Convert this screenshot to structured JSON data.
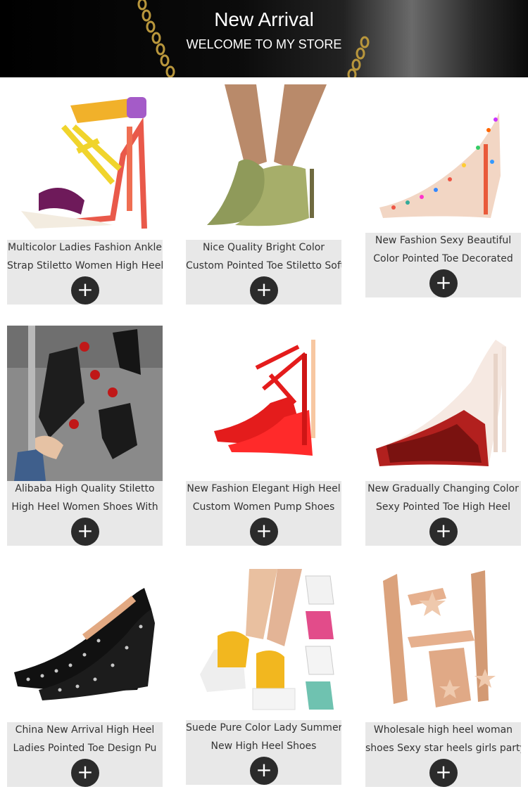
{
  "banner": {
    "title": "New Arrival",
    "subtitle": "WELCOME TO MY STORE"
  },
  "products": [
    {
      "line1": "Multicolor Ladies Fashion Ankle",
      "line2": "Strap Stiletto Women High Heel",
      "add_label": "+",
      "image_icon": "strappy-sandal-image"
    },
    {
      "line1": "Nice Quality Bright Color",
      "line2": "Custom Pointed Toe Stiletto Soft",
      "add_label": "+",
      "image_icon": "olive-mule-image"
    },
    {
      "line1": "New Fashion Sexy Beautiful",
      "line2": "Color Pointed Toe Decorated",
      "add_label": "+",
      "image_icon": "studded-pump-image"
    },
    {
      "line1": "Alibaba High Quality Stiletto",
      "line2": "High Heel Women Shoes With",
      "add_label": "+",
      "image_icon": "sock-boot-image"
    },
    {
      "line1": "New Fashion Elegant High Heel",
      "line2": "Custom Women Pump Shoes",
      "add_label": "+",
      "image_icon": "red-cross-strap-pump-image"
    },
    {
      "line1": "New Gradually Changing Color",
      "line2": "Sexy Pointed Toe High Heel",
      "add_label": "+",
      "image_icon": "gradient-leopard-pump-image"
    },
    {
      "line1": "China New Arrival High Heel",
      "line2": "Ladies Pointed Toe Design Pu",
      "add_label": "+",
      "image_icon": "black-studded-pump-image"
    },
    {
      "line1": "Suede Pure Color Lady Summer",
      "line2": "New High Heel Shoes",
      "add_label": "+",
      "image_icon": "platform-peep-toe-image"
    },
    {
      "line1": "Wholesale high heel woman",
      "line2": "shoes Sexy star heels girls party",
      "add_label": "+",
      "image_icon": "star-sandal-image"
    }
  ],
  "colors": {
    "caption_bg": "#e8e8e8",
    "button_bg": "#2b2b2b",
    "banner_bg": "#000000"
  }
}
